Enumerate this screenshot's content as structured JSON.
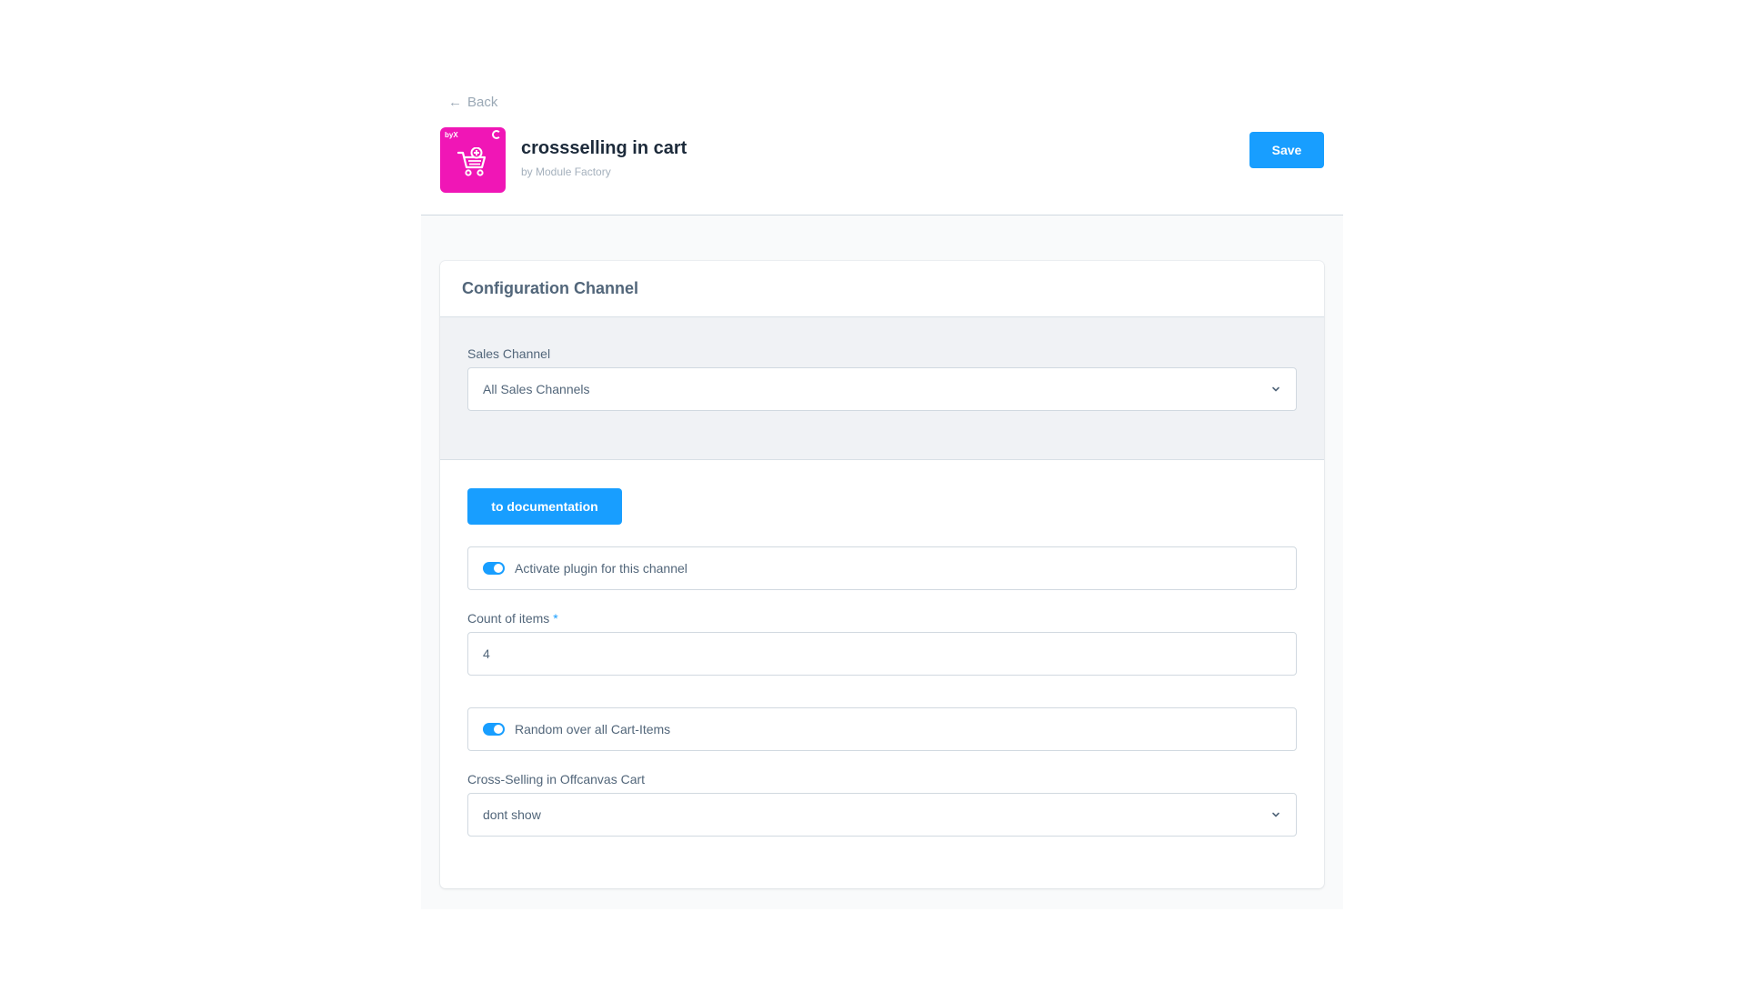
{
  "nav": {
    "back_label": "Back"
  },
  "header": {
    "app_icon_brand": "byX",
    "title": "crossselling in cart",
    "subtitle": "by Module Factory",
    "save_label": "Save"
  },
  "card": {
    "title": "Configuration Channel",
    "sales_channel": {
      "label": "Sales Channel",
      "value": "All Sales Channels"
    },
    "doc_button_label": "to documentation",
    "activate_plugin": {
      "label": "Activate plugin for this channel",
      "enabled": true
    },
    "count_items": {
      "label": "Count of items",
      "required_mark": "*",
      "value": "4"
    },
    "random_cart_items": {
      "label": "Random over all Cart-Items",
      "enabled": true
    },
    "offcanvas": {
      "label": "Cross-Selling in Offcanvas Cart",
      "value": "dont show"
    }
  },
  "colors": {
    "accent": "#189eff",
    "app_icon": "#f016b6",
    "panel_bg": "#f0f2f5"
  }
}
